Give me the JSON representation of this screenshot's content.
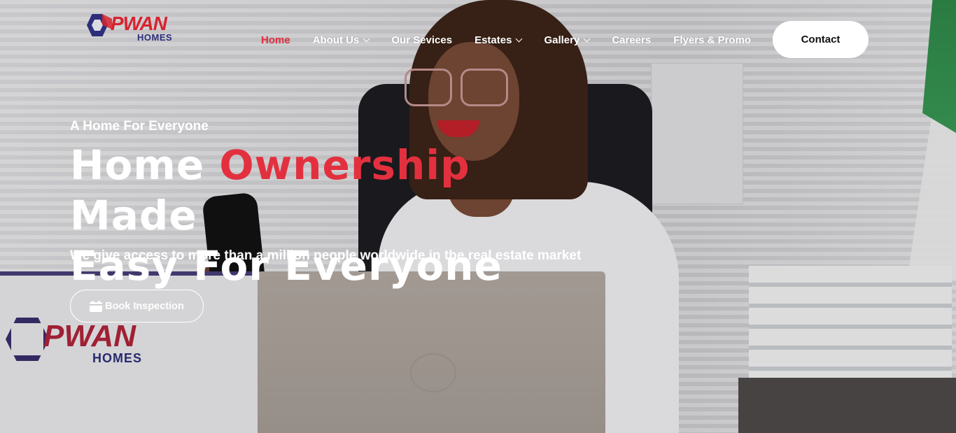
{
  "brand": {
    "name": "PWAN",
    "sub": "HOMES",
    "primary_color": "#d8232f",
    "secondary_color": "#2d2f7a"
  },
  "nav": {
    "items": [
      {
        "label": "Home",
        "active": true,
        "dropdown": false
      },
      {
        "label": "About Us",
        "active": false,
        "dropdown": true
      },
      {
        "label": "Our Sevices",
        "active": false,
        "dropdown": false
      },
      {
        "label": "Estates",
        "active": false,
        "dropdown": true
      },
      {
        "label": "Gallery",
        "active": false,
        "dropdown": true
      },
      {
        "label": "Careers",
        "active": false,
        "dropdown": false
      },
      {
        "label": "Flyers & Promo",
        "active": false,
        "dropdown": false
      }
    ],
    "contact_label": "Contact",
    "accent_color": "#e3303f"
  },
  "hero": {
    "eyebrow": "A Home For Everyone",
    "headline_part1": "Home ",
    "headline_accent": "Ownership",
    "headline_part2": " Made",
    "headline_line2": "Easy For Everyone",
    "subline": "We give access to more than a million people worldwide in the real estate market",
    "cta_label": "Book Inspection",
    "cta_icon": "calendar-icon"
  },
  "background": {
    "sign_text": "PWAN",
    "sign_sub": "HOMES"
  }
}
